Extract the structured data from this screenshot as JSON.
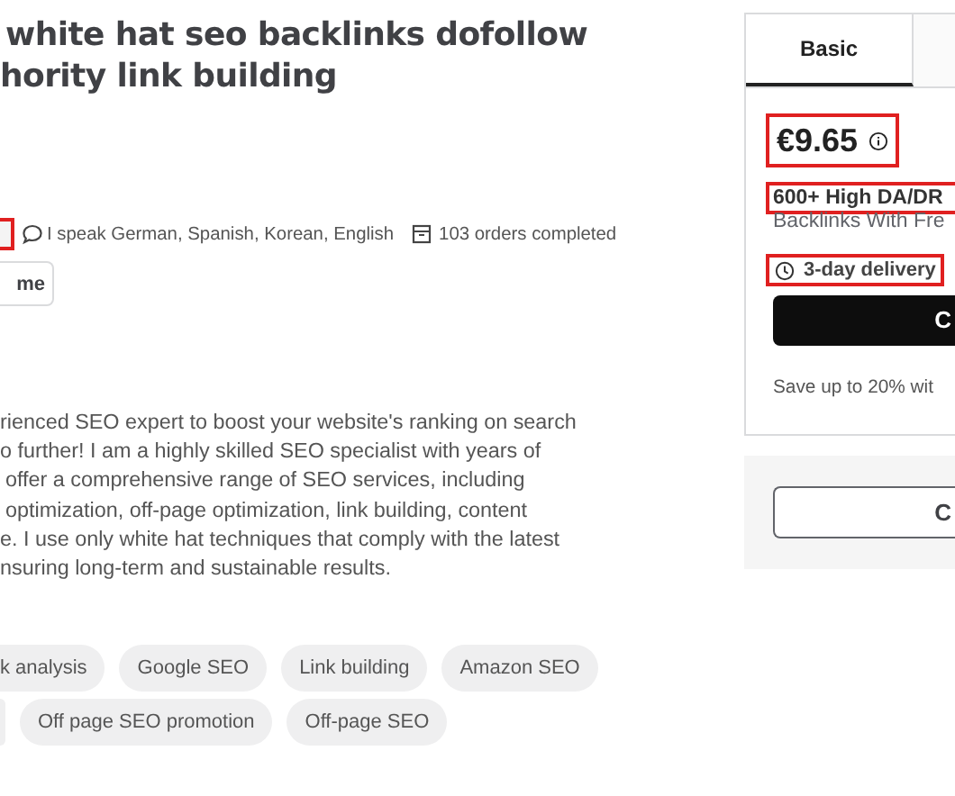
{
  "gig": {
    "title_lines": [
      "white hat seo backlinks dofollow",
      "hority link building"
    ],
    "meta": {
      "cut_item_highlighted": true,
      "languages": "I speak German, Spanish, Korean, English",
      "orders": "103 orders completed"
    },
    "contact_button": "me",
    "description": [
      "rienced SEO expert to boost your website's ranking on search",
      "o further! I am a highly skilled SEO specialist with years of",
      "offer a comprehensive range of SEO services, including",
      "optimization, off-page optimization, link building, content",
      "e. I use only white hat techniques that comply with the latest",
      "nsuring long-term and sustainable results."
    ],
    "tag_rows": [
      [
        "k analysis",
        "Google SEO",
        "Link building",
        "Amazon SEO"
      ],
      [
        "",
        "Off page SEO promotion",
        "Off-page SEO"
      ]
    ]
  },
  "package": {
    "tabs": [
      {
        "label": "Basic",
        "selected": true
      },
      {
        "selected": false
      }
    ],
    "price": {
      "text": "€9.65",
      "highlighted": true
    },
    "name": {
      "text": "600+ High DA/DR",
      "highlighted": true
    },
    "subtitle": "Backlinks With Fre",
    "delivery": {
      "text": "3-day delivery",
      "highlighted": true
    },
    "continue_button": "C",
    "save_note": "Save up to 20% wit",
    "contact_button": "C"
  }
}
